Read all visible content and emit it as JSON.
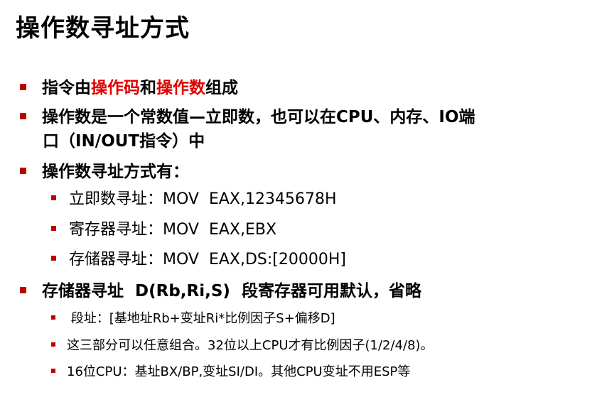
{
  "title": "操作数寻址方式",
  "colors": {
    "bullet": "#c00000",
    "highlight": "#e00000",
    "text": "#000000"
  },
  "line1": {
    "prefix": "指令由",
    "red1": "操作码",
    "mid": "和",
    "red2": "操作数",
    "suffix": "组成"
  },
  "line2": {
    "text": "操作数是一个常数值—立即数，也可以在CPU、内存、IO端",
    "continuation": "口（IN/OUT指令）中"
  },
  "line3": {
    "text": "操作数寻址方式有："
  },
  "modes": [
    "立即数寻址：MOV  EAX,12345678H",
    "寄存器寻址：MOV  EAX,EBX",
    "存储器寻址：MOV  EAX,DS:[20000H]"
  ],
  "line4": {
    "text": "存储器寻址  D(Rb,Ri,S)  段寄存器可用默认，省略"
  },
  "details": [
    " 段址：[基地址Rb+变址Ri*比例因子S+偏移D]",
    "这三部分可以任意组合。32位以上CPU才有比例因子(1/2/4/8)。",
    "16位CPU：基址BX/BP,变址SI/DI。其他CPU变址不用ESP等"
  ]
}
